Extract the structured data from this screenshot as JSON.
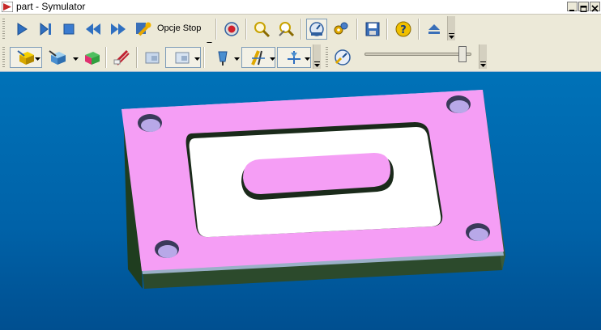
{
  "window": {
    "title": "part - Symulator",
    "buttons": [
      "minimize",
      "maximize",
      "close"
    ]
  },
  "toolbar1": {
    "items": [
      {
        "icon": "play-icon"
      },
      {
        "icon": "step-icon"
      },
      {
        "icon": "stop-icon"
      },
      {
        "icon": "rewind-icon"
      },
      {
        "icon": "fast-forward-icon"
      },
      {
        "icon": "wrench-icon"
      },
      {
        "icon": "record-icon"
      },
      {
        "icon": "zoom-icon"
      },
      {
        "icon": "zoom-area-icon"
      },
      {
        "icon": "dial-icon"
      },
      {
        "icon": "gears-icon"
      },
      {
        "icon": "save-icon"
      },
      {
        "icon": "help-icon"
      },
      {
        "icon": "eject-icon"
      }
    ],
    "option_select": "Opcje Stop"
  },
  "toolbar2": {
    "items": [
      {
        "icon": "stock-view-icon"
      },
      {
        "icon": "part-view-icon"
      },
      {
        "icon": "compare-icon"
      },
      {
        "icon": "gouge-icon"
      },
      {
        "icon": "section-icon"
      },
      {
        "icon": "section-dropdown-icon"
      },
      {
        "icon": "tool-view-icon"
      },
      {
        "icon": "tool-path-icon"
      },
      {
        "icon": "axis-icon"
      },
      {
        "icon": "speed-icon"
      }
    ],
    "speed_slider_value": 0.95
  },
  "viewport": {
    "background": "#0066ad",
    "part_color": "#f59ef5",
    "pocket_color": "#ffffff"
  }
}
